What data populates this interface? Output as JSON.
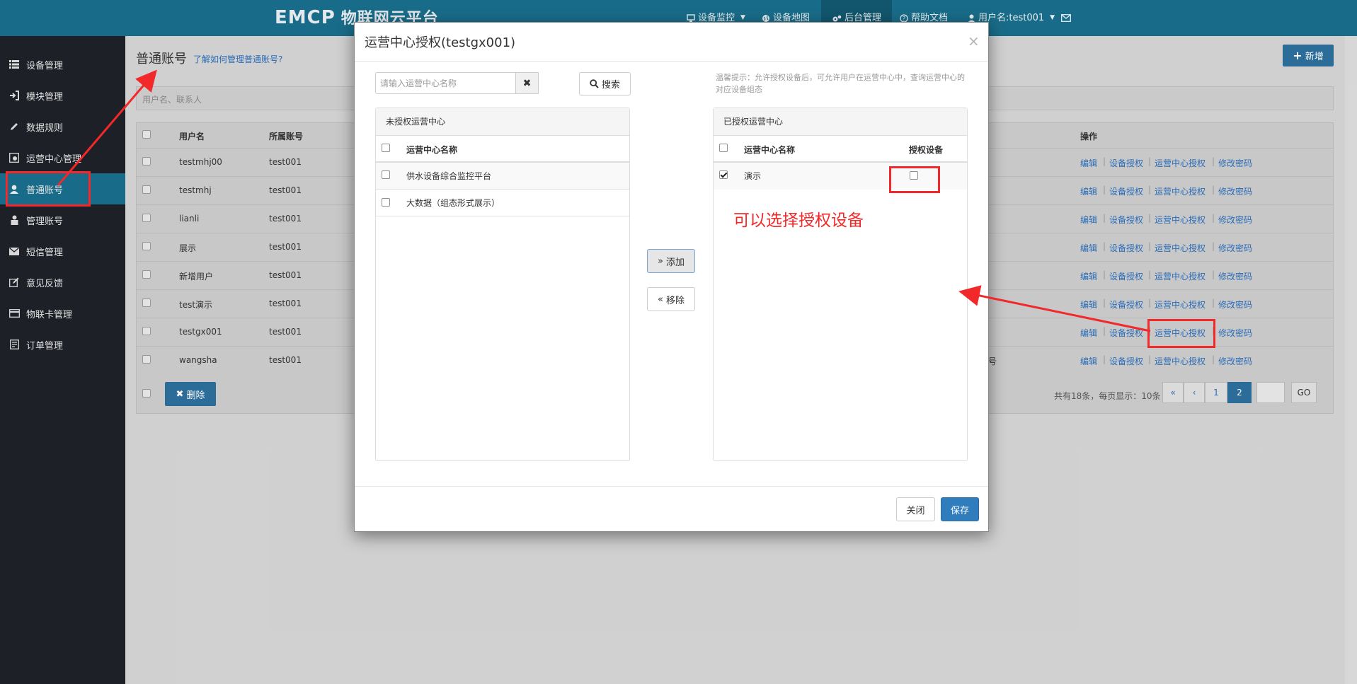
{
  "topnav": {
    "logo_text": "EMCP",
    "logo_cn": "物联网云平台",
    "items": [
      {
        "label": "设备监控",
        "icon": "monitor-icon",
        "has_caret": true
      },
      {
        "label": "设备地图",
        "icon": "globe-icon"
      },
      {
        "label": "后台管理",
        "icon": "gears-icon",
        "active": true
      },
      {
        "label": "帮助文档",
        "icon": "question-icon"
      },
      {
        "label": "用户名:test001",
        "icon": "user-icon",
        "has_caret": true
      }
    ],
    "mail_icon": "envelope-icon"
  },
  "sidebar": {
    "items": [
      {
        "label": "设备管理",
        "icon": "list-icon"
      },
      {
        "label": "模块管理",
        "icon": "sign-in-icon"
      },
      {
        "label": "数据规则",
        "icon": "pencil-icon"
      },
      {
        "label": "运营中心管理",
        "icon": "settings-box-icon"
      },
      {
        "label": "普通账号",
        "icon": "user-icon",
        "active": true
      },
      {
        "label": "管理账号",
        "icon": "user-lock-icon"
      },
      {
        "label": "短信管理",
        "icon": "envelope-icon"
      },
      {
        "label": "意见反馈",
        "icon": "edit-icon"
      },
      {
        "label": "物联卡管理",
        "icon": "card-icon"
      },
      {
        "label": "订单管理",
        "icon": "order-icon"
      }
    ]
  },
  "page": {
    "title": "普通账号",
    "help_link": "了解如何管理普通账号?",
    "add_button": "新增",
    "filter_placeholder": "用户名、联系人",
    "columns": {
      "username": "用户名",
      "account": "所属账号",
      "ops": "操作"
    },
    "rows": [
      {
        "username": "testmhj00",
        "account": "test001",
        "extra": ""
      },
      {
        "username": "testmhj",
        "account": "test001",
        "extra": ""
      },
      {
        "username": "lianli",
        "account": "test001",
        "extra": ""
      },
      {
        "username": "展示",
        "account": "test001",
        "extra": ""
      },
      {
        "username": "新增用户",
        "account": "test001",
        "extra": ""
      },
      {
        "username": "test演示",
        "account": "test001",
        "extra": ""
      },
      {
        "username": "testgx001",
        "account": "test001",
        "extra": ""
      },
      {
        "username": "wangsha",
        "account": "test001",
        "extra": "号"
      }
    ],
    "row_ops": [
      "编辑",
      "设备授权",
      "运营中心授权",
      "修改密码"
    ],
    "delete_button": "删除",
    "pagination": {
      "total_text": "共有18条，每页显示：10条",
      "buttons": [
        "«",
        "‹",
        "1",
        "2"
      ],
      "current_page": "2",
      "go_label": "GO"
    }
  },
  "modal": {
    "title": "运营中心授权(testgx001)",
    "close_glyph": "×",
    "search_placeholder": "请输入运营中心名称",
    "clear_glyph": "✖",
    "search_button": "搜索",
    "hint": "温馨提示：允许授权设备后，可允许用户在运营中心中，查询运营中心的对应设备组态",
    "left_panel": {
      "heading": "未授权运营中心",
      "col_name": "运营中心名称",
      "items": [
        "供水设备综合监控平台",
        "大数据（组态形式展示）"
      ]
    },
    "right_panel": {
      "heading": "已授权运营中心",
      "col_name": "运营中心名称",
      "col_device": "授权设备",
      "items": [
        {
          "name": "演示",
          "checked": true,
          "device_authorized": false
        }
      ]
    },
    "add_button": "添加",
    "remove_button": "移除",
    "close_button": "关闭",
    "save_button": "保存"
  },
  "annotation": {
    "text": "可以选择授权设备",
    "color": "#f2292b"
  }
}
